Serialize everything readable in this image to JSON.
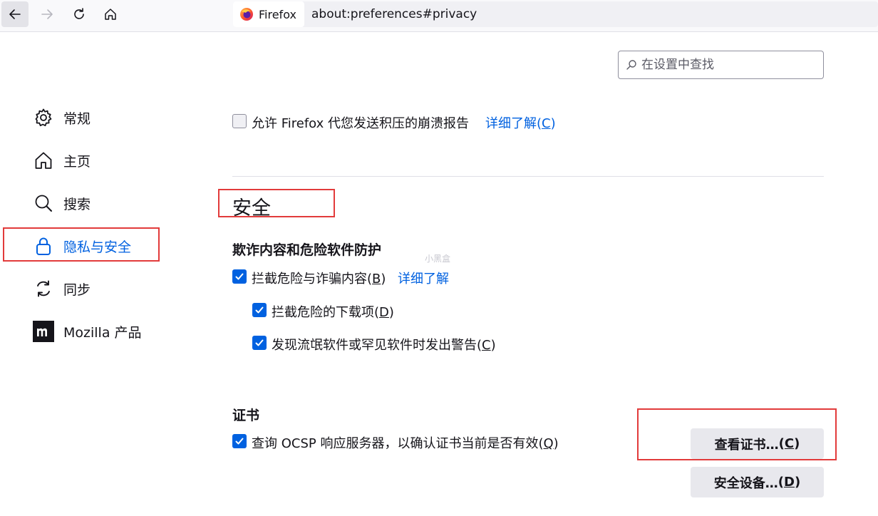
{
  "toolbar": {
    "back_icon": "arrow-left-icon",
    "forward_icon": "arrow-right-icon",
    "reload_icon": "reload-icon",
    "home_icon": "home-icon",
    "identity_label": "Firefox",
    "url": "about:preferences#privacy"
  },
  "search": {
    "placeholder": "在设置中查找"
  },
  "sidebar": {
    "items": [
      {
        "label": "常规",
        "icon": "gear-icon"
      },
      {
        "label": "主页",
        "icon": "home-icon"
      },
      {
        "label": "搜索",
        "icon": "search-icon"
      },
      {
        "label": "隐私与安全",
        "icon": "lock-icon",
        "active": true
      },
      {
        "label": "同步",
        "icon": "sync-icon"
      },
      {
        "label": "Mozilla 产品",
        "icon": "mozilla-icon"
      }
    ]
  },
  "crash_report": {
    "label": "允许 Firefox 代您发送积压的崩溃报告",
    "checked": false,
    "link_text": "详细了解",
    "accesskey_open": "(",
    "accesskey": "C",
    "accesskey_close": ")"
  },
  "security": {
    "title": "安全",
    "watermark": "小黑盒",
    "deceptive": {
      "heading": "欺诈内容和危险软件防护",
      "block_dangerous": {
        "label": "拦截危险与诈骗内容",
        "accesskey": "B",
        "checked": true,
        "link_text": "详细了解"
      },
      "block_downloads": {
        "label": "拦截危险的下载项",
        "accesskey": "D",
        "checked": true
      },
      "warn_unwanted": {
        "label": "发现流氓软件或罕见软件时发出警告",
        "accesskey": "C",
        "checked": true
      }
    },
    "certificates": {
      "heading": "证书",
      "ocsp": {
        "label": "查询 OCSP 响应服务器，以确认证书当前是否有效",
        "accesskey": "Q",
        "checked": true
      },
      "view_button": {
        "label": "查看证书…",
        "accesskey": "C"
      },
      "devices_button": {
        "label": "安全设备…",
        "accesskey": "D"
      }
    }
  },
  "colors": {
    "accent": "#0061e0",
    "highlight_box": "#e23b3b"
  }
}
